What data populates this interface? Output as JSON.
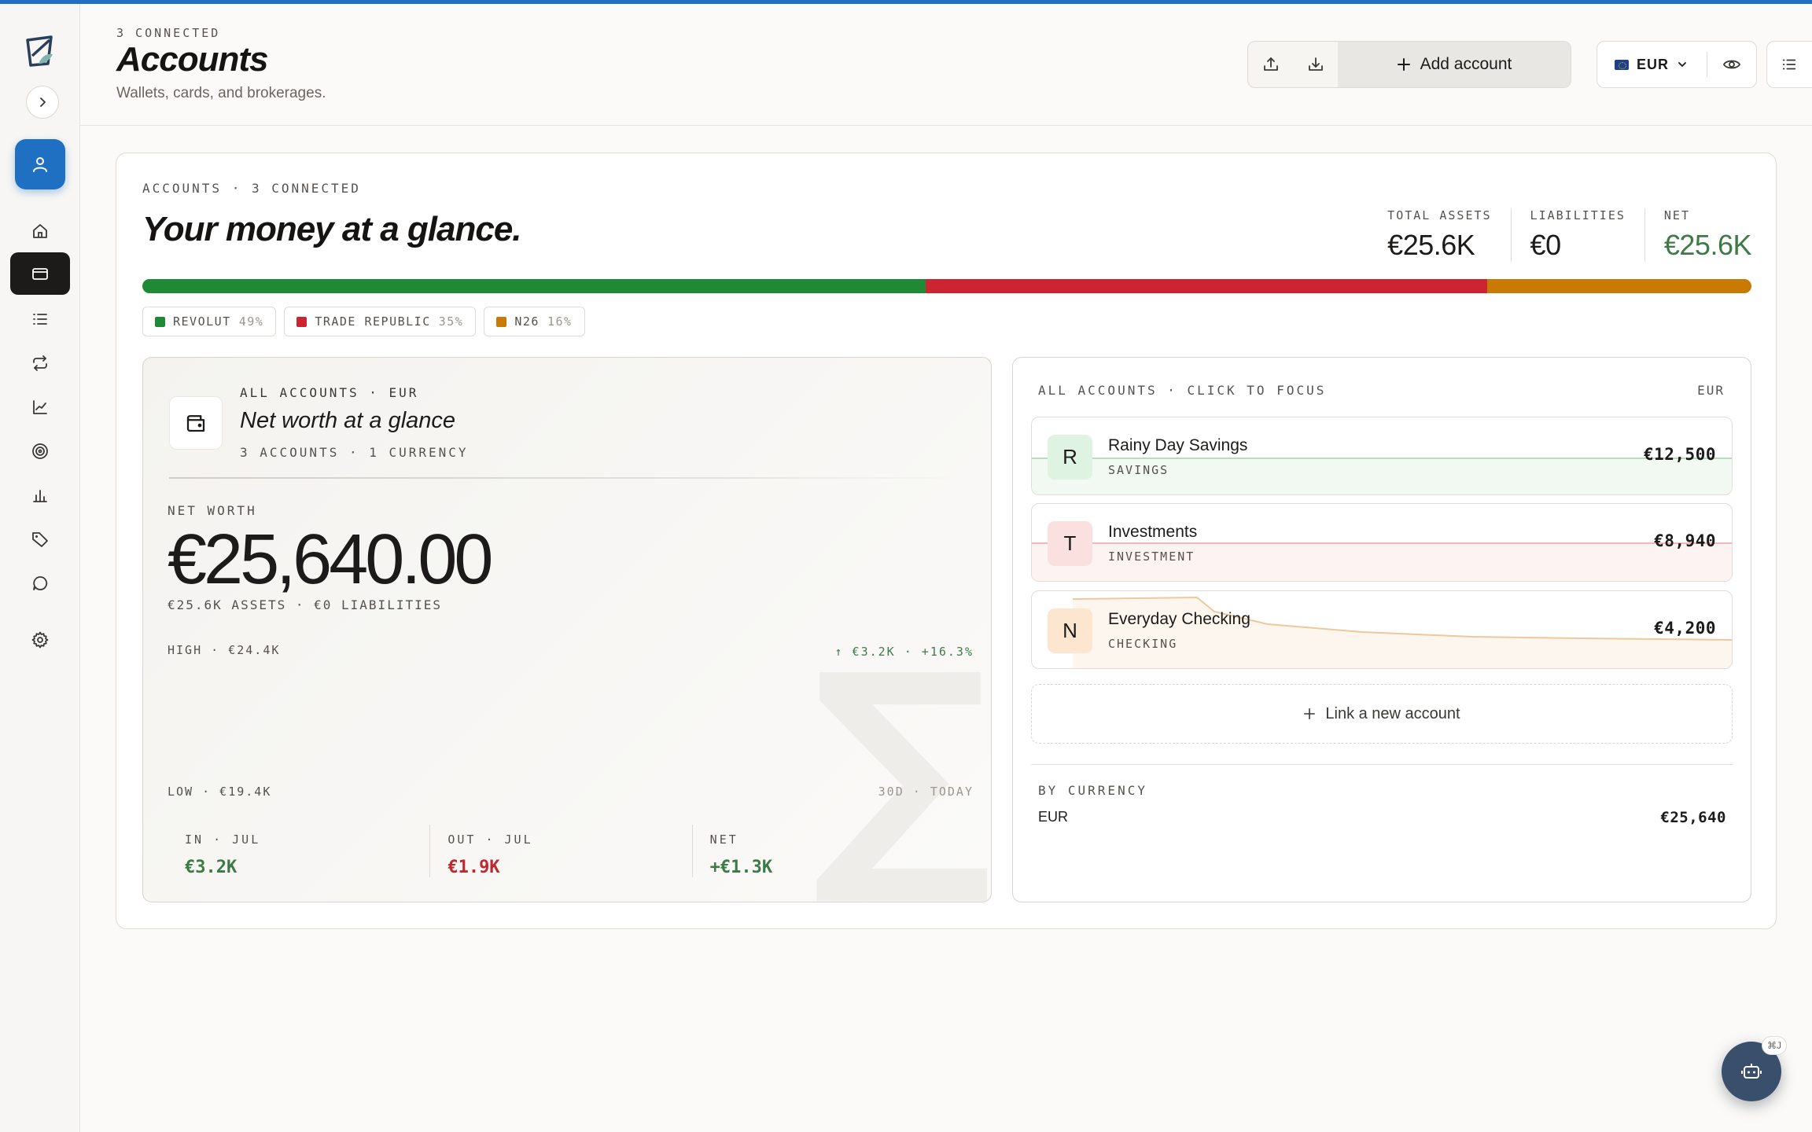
{
  "header": {
    "kicker": "3 CONNECTED",
    "title": "Accounts",
    "subtitle": "Wallets, cards, and brokerages.",
    "add_account_label": "Add account",
    "currency": "EUR"
  },
  "overview": {
    "kicker": "ACCOUNTS · 3 CONNECTED",
    "title": "Your money at a glance.",
    "stats": {
      "total_assets_label": "TOTAL ASSETS",
      "total_assets_value": "€25.6K",
      "liabilities_label": "LIABILITIES",
      "liabilities_value": "€0",
      "net_label": "NET",
      "net_value": "€25.6K"
    },
    "allocation": [
      {
        "name": "REVOLUT",
        "pct_label": "49%",
        "share": 0.487,
        "color": "#1f8a36"
      },
      {
        "name": "TRADE REPUBLIC",
        "pct_label": "35%",
        "share": 0.349,
        "color": "#cc2430"
      },
      {
        "name": "N26",
        "pct_label": "16%",
        "share": 0.164,
        "color": "#c87a05"
      }
    ]
  },
  "summary": {
    "kicker": "ALL ACCOUNTS · EUR",
    "title": "Net worth at a glance",
    "subtitle": "3 ACCOUNTS · 1 CURRENCY",
    "net_worth_label": "NET WORTH",
    "net_worth_value": "€25,640.00",
    "breakdown": "€25.6K ASSETS · €0 LIABILITIES",
    "high": "HIGH · €24.4K",
    "low": "LOW · €19.4K",
    "change": "↑ €3.2K · +16.3%",
    "range": "30D · TODAY",
    "glyph": "∑",
    "flows": {
      "in_label": "IN · JUL",
      "in_value": "€3.2K",
      "out_label": "OUT · JUL",
      "out_value": "€1.9K",
      "net_label": "NET",
      "net_value": "+€1.3K"
    }
  },
  "accounts_panel": {
    "kicker": "ALL ACCOUNTS · CLICK TO FOCUS",
    "currency": "EUR",
    "accounts": [
      {
        "initial": "R",
        "name": "Rainy Day Savings",
        "type": "SAVINGS",
        "balance": "€12,500",
        "avatar_bg": "#dff3e2",
        "line_color": "#b9dcbf",
        "fill": "#f1f9f2"
      },
      {
        "initial": "T",
        "name": "Investments",
        "type": "INVESTMENT",
        "balance": "€8,940",
        "avatar_bg": "#fbe0e0",
        "line_color": "#efb9b9",
        "fill": "#fdf3f3"
      },
      {
        "initial": "N",
        "name": "Everyday Checking",
        "type": "CHECKING",
        "balance": "€4,200",
        "avatar_bg": "#fde6cf",
        "line_color": "#ecc99c",
        "fill": "#fdf6ee"
      }
    ],
    "link_new_label": "Link a new account",
    "by_currency_label": "BY CURRENCY",
    "by_currency": [
      {
        "code": "EUR",
        "value": "€25,640"
      }
    ]
  },
  "bot": {
    "shortcut": "⌘J"
  }
}
